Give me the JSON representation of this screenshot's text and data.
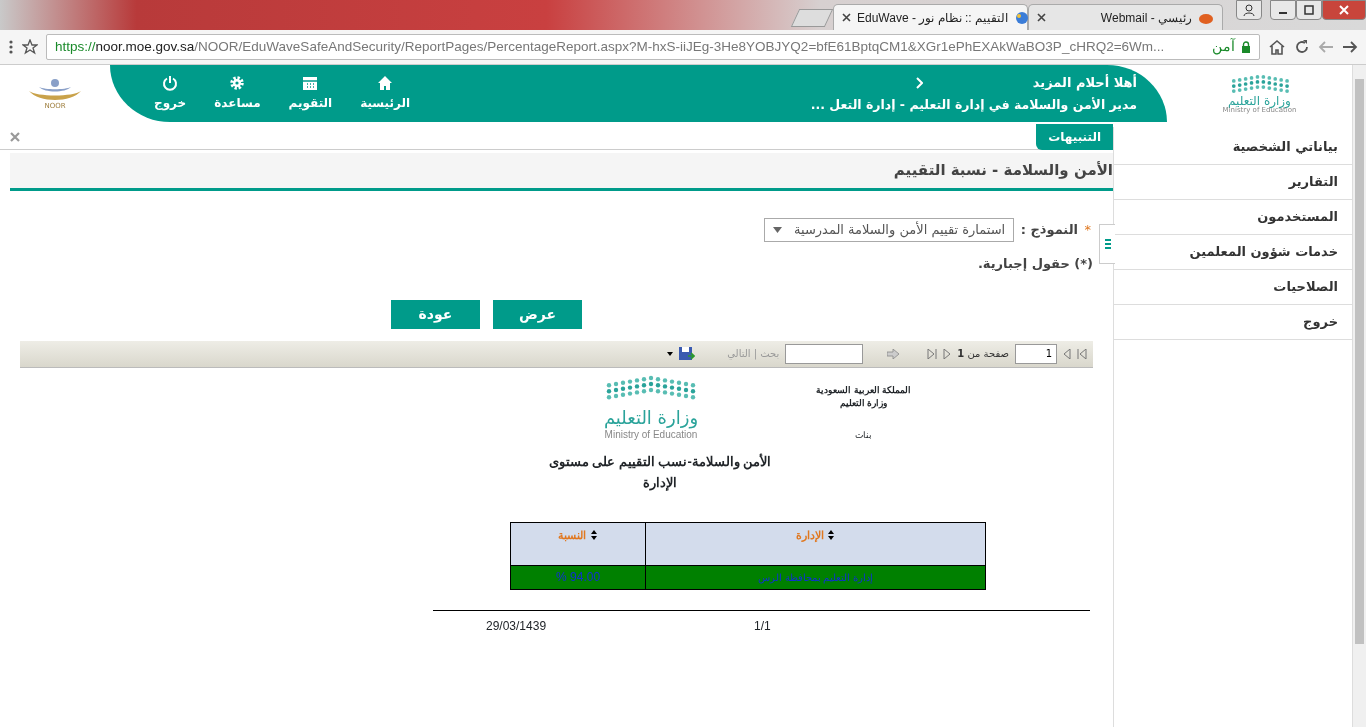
{
  "browser": {
    "tabs": [
      {
        "title": "رئيسي - Webmail",
        "selected": false
      },
      {
        "title": "التقييم :: نظام نور - EduWave",
        "selected": true
      }
    ],
    "url_scheme": "https://",
    "url_host": "noor.moe.gov.sa",
    "url_path": "/NOOR/EduWaveSafeAndSecurity/ReportPages/PercentageReport.aspx?M-hxS-iiJEg-3He8YOBJYQ2=bfE61BptqCM1&XGr1ePhEXAkWaBO3P_cHRQ2=6Wm...",
    "secure_label": "آمن"
  },
  "header": {
    "logo_ar": "وزارة التعليم",
    "logo_en": "Ministry of Education",
    "greeting": "أهلا أحلام المزيد",
    "role": "مدير الأمن والسلامة في إدارة التعليم - إدارة التعل ...",
    "nav": [
      {
        "label": "الرئيسية",
        "kind": "home"
      },
      {
        "label": "التقويم",
        "kind": "calendar"
      },
      {
        "label": "مساعدة",
        "kind": "settings"
      },
      {
        "label": "خروج",
        "kind": "exit"
      }
    ],
    "noor_logo": "NOOR"
  },
  "alerts": {
    "tab": "التنبيهات"
  },
  "sidebar": {
    "items": [
      "بياناتي الشخصية",
      "التقارير",
      "المستخدمون",
      "خدمات شؤون المعلمين",
      "الصلاحيات",
      "خروج"
    ]
  },
  "page": {
    "title": "الأمن والسلامة - نسبة التقييم",
    "form": {
      "required_mark": "*",
      "label": "النموذج :",
      "value": "استمارة تقييم الأمن والسلامة المدرسية"
    },
    "required_note": "(*) حقول إجبارية.",
    "buttons": [
      {
        "label": "عرض"
      },
      {
        "label": "عودة"
      }
    ]
  },
  "report_toolbar": {
    "page": "1",
    "page_of": "صفحة من **1**",
    "find_links": "بحث | التالي"
  },
  "report": {
    "header_lines": [
      "المملكة العربية السعودية",
      "وزارة التعليم"
    ],
    "section": "بنات",
    "logo_ar": "وزارة التعليم",
    "logo_en": "Ministry of Education",
    "title": "الأمن والسلامة-نسب التقييم على مستوى الإدارة",
    "table": {
      "columns": [
        "الإدارة",
        "النسبة"
      ],
      "rows": [
        {
          "cells": [
            "إدارة التعليم بمحافظة الرس",
            "94.00 %"
          ]
        }
      ]
    },
    "footer": {
      "date": "29/03/1439",
      "page": "1/1"
    }
  }
}
